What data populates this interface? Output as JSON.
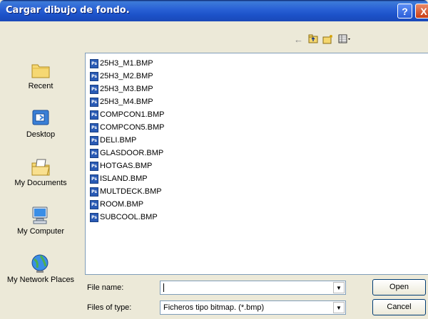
{
  "window": {
    "title": "Cargar dibujo de fondo.",
    "help_label": "?",
    "close_label": "X"
  },
  "toolbar": {
    "back_icon": "back-arrow-icon",
    "up_icon": "up-folder-icon",
    "new_folder_icon": "new-folder-icon",
    "views_icon": "views-menu-icon"
  },
  "places": [
    {
      "label": "Recent",
      "icon": "recent-folder-icon"
    },
    {
      "label": "Desktop",
      "icon": "desktop-icon"
    },
    {
      "label": "My Documents",
      "icon": "my-documents-icon"
    },
    {
      "label": "My Computer",
      "icon": "my-computer-icon"
    },
    {
      "label": "My Network Places",
      "icon": "network-places-icon"
    }
  ],
  "files": [
    "25H3_M1.BMP",
    "25H3_M2.BMP",
    "25H3_M3.BMP",
    "25H3_M4.BMP",
    "COMPCON1.BMP",
    "COMPCON5.BMP",
    "DELI.BMP",
    "GLASDOOR.BMP",
    "HOTGAS.BMP",
    "ISLAND.BMP",
    "MULTDECK.BMP",
    "ROOM.BMP",
    "SUBCOOL.BMP"
  ],
  "file_icon_text": "Ps",
  "form": {
    "file_name_label": "File name:",
    "file_name_value": "",
    "file_type_label": "Files of type:",
    "file_type_value": "Ficheros tipo bitmap. (*.bmp)",
    "open_label": "Open",
    "cancel_label": "Cancel"
  }
}
